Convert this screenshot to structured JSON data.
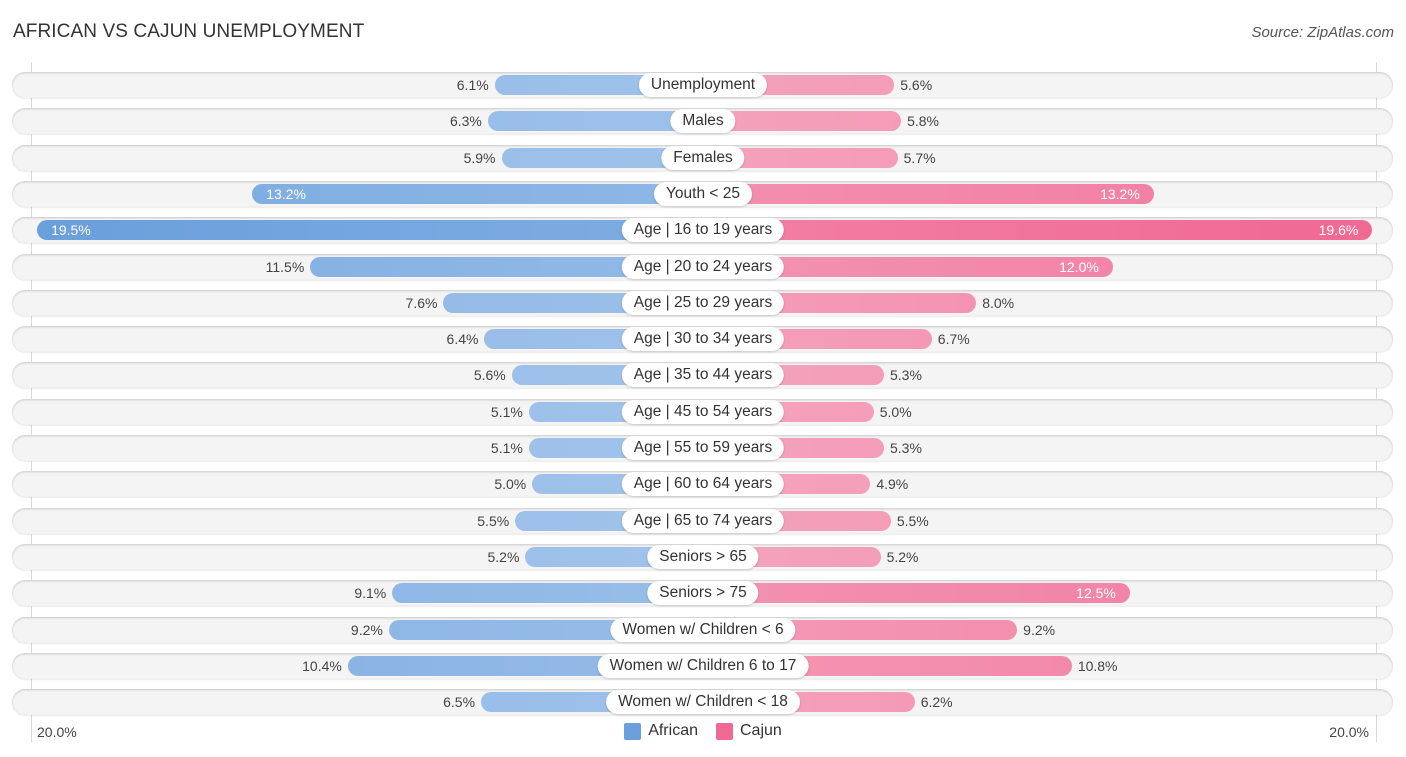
{
  "header": {
    "title": "AFRICAN VS CAJUN UNEMPLOYMENT",
    "source": "Source: ZipAtlas.com"
  },
  "chart_data": {
    "type": "bar",
    "orientation": "horizontal-diverging",
    "title": "AFRICAN VS CAJUN UNEMPLOYMENT",
    "xlabel": "",
    "ylabel": "",
    "xlim": [
      -20.0,
      20.0
    ],
    "unit": "%",
    "axis_tick_labels": {
      "left": "20.0%",
      "right": "20.0%"
    },
    "legend_position": "bottom-center",
    "categories": [
      "Unemployment",
      "Males",
      "Females",
      "Youth < 25",
      "Age | 16 to 19 years",
      "Age | 20 to 24 years",
      "Age | 25 to 29 years",
      "Age | 30 to 34 years",
      "Age | 35 to 44 years",
      "Age | 45 to 54 years",
      "Age | 55 to 59 years",
      "Age | 60 to 64 years",
      "Age | 65 to 74 years",
      "Seniors > 65",
      "Seniors > 75",
      "Women w/ Children < 6",
      "Women w/ Children 6 to 17",
      "Women w/ Children < 18"
    ],
    "series": [
      {
        "name": "African",
        "side": "left",
        "color": "#6a9fdc",
        "values": [
          6.1,
          6.3,
          5.9,
          13.2,
          19.5,
          11.5,
          7.6,
          6.4,
          5.6,
          5.1,
          5.1,
          5.0,
          5.5,
          5.2,
          9.1,
          9.2,
          10.4,
          6.5
        ],
        "labels": [
          "6.1%",
          "6.3%",
          "5.9%",
          "13.2%",
          "19.5%",
          "11.5%",
          "7.6%",
          "6.4%",
          "5.6%",
          "5.1%",
          "5.1%",
          "5.0%",
          "5.5%",
          "5.2%",
          "9.1%",
          "9.2%",
          "10.4%",
          "6.5%"
        ]
      },
      {
        "name": "Cajun",
        "side": "right",
        "color": "#f06994",
        "values": [
          5.6,
          5.8,
          5.7,
          13.2,
          19.6,
          12.0,
          8.0,
          6.7,
          5.3,
          5.0,
          5.3,
          4.9,
          5.5,
          5.2,
          12.5,
          9.2,
          10.8,
          6.2
        ],
        "labels": [
          "5.6%",
          "5.8%",
          "5.7%",
          "13.2%",
          "19.6%",
          "12.0%",
          "8.0%",
          "6.7%",
          "5.3%",
          "5.0%",
          "5.3%",
          "4.9%",
          "5.5%",
          "5.2%",
          "12.5%",
          "9.2%",
          "10.8%",
          "6.2%"
        ]
      }
    ]
  },
  "legend": {
    "items": [
      {
        "label": "African",
        "color": "#6a9fdc"
      },
      {
        "label": "Cajun",
        "color": "#f06994"
      }
    ]
  }
}
